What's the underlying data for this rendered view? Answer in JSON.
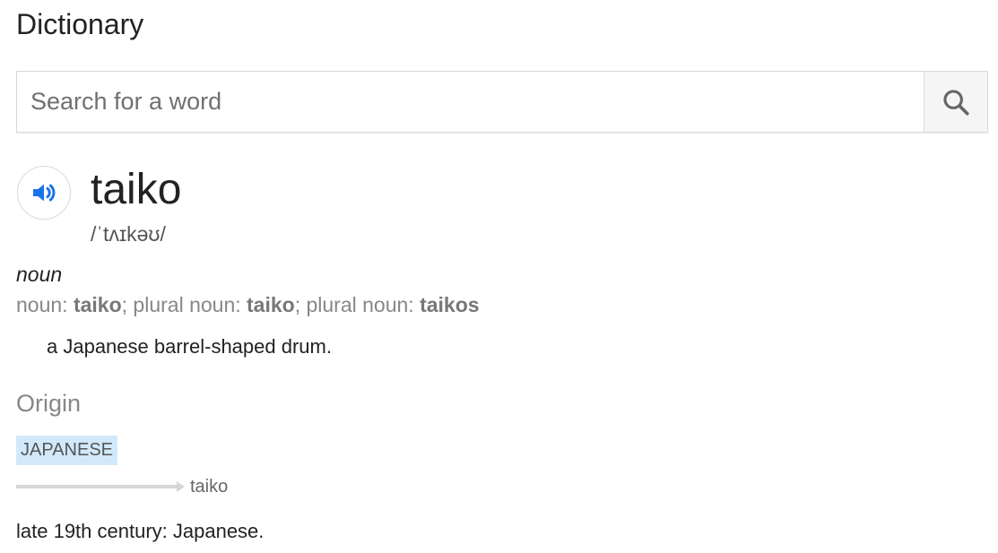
{
  "header": {
    "title": "Dictionary"
  },
  "search": {
    "placeholder": "Search for a word",
    "value": "",
    "icon": "search-icon"
  },
  "entry": {
    "audio_icon": "speaker-icon",
    "accent_color": "#1a73e8",
    "word": "taiko",
    "phonetic": "/ˈtʌɪkəʊ/",
    "part_of_speech": "noun",
    "forms": {
      "label1": "noun: ",
      "form1": "taiko",
      "sep1": "; plural noun: ",
      "form2": "taiko",
      "sep2": "; plural noun: ",
      "form3": "taikos"
    },
    "definition": "a Japanese barrel-shaped drum."
  },
  "origin": {
    "heading": "Origin",
    "language": "JAPANESE",
    "language_tag_color": "#d2e9fb",
    "derived_word": "taiko",
    "text": "late 19th century: Japanese."
  }
}
